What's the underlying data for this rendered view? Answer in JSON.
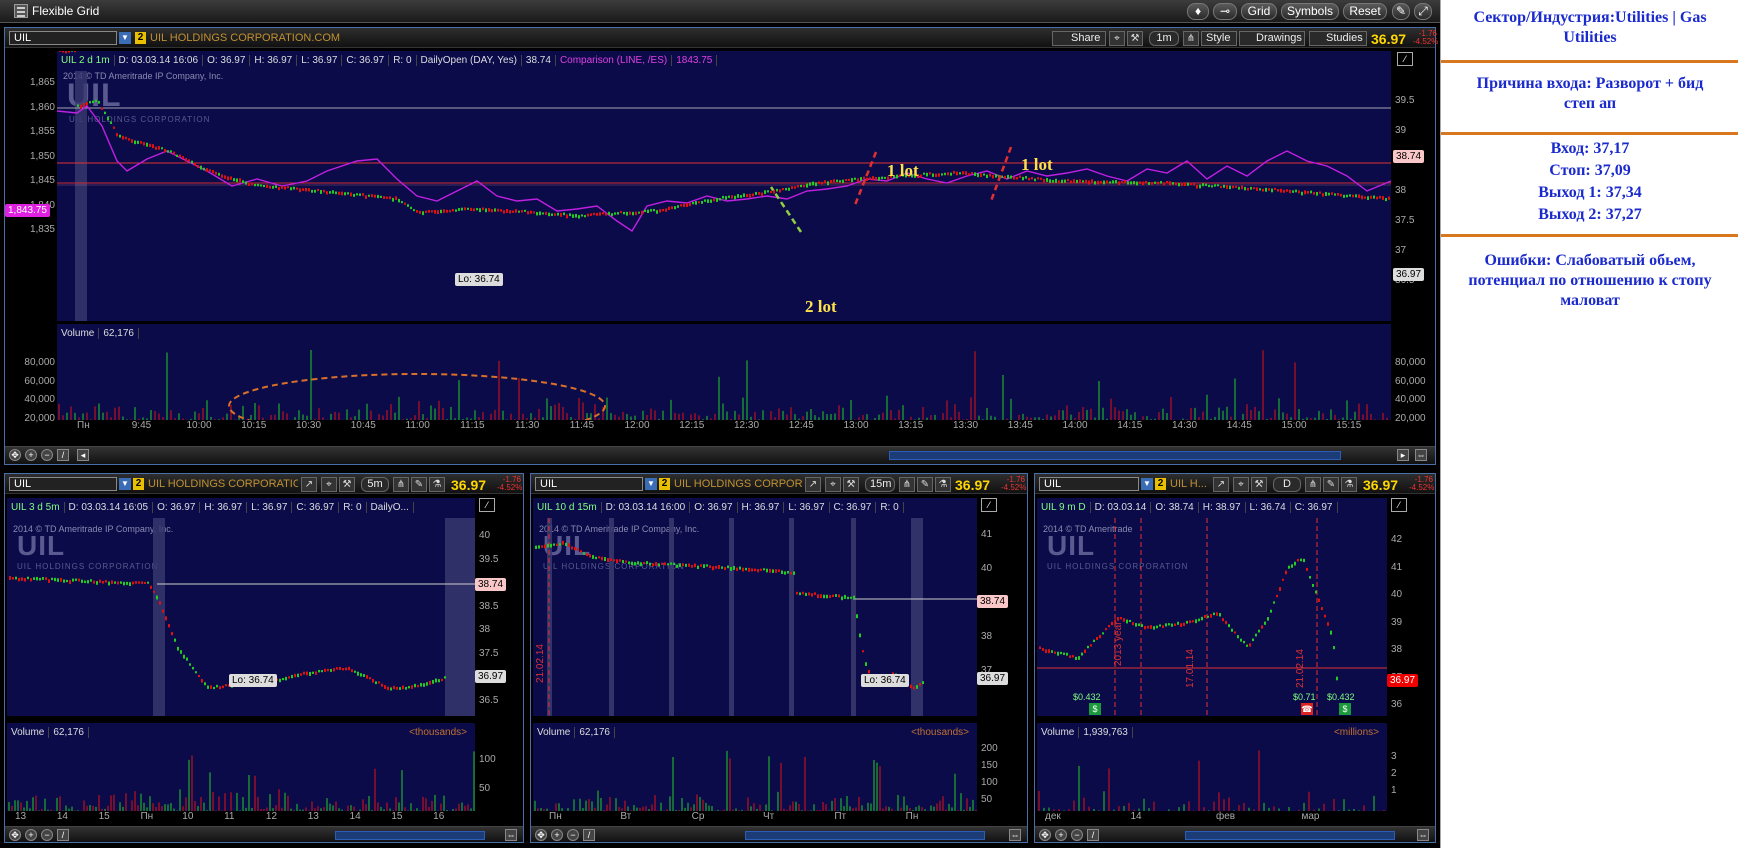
{
  "app": {
    "title": "Flexible Grid",
    "buttons": [
      "Grid",
      "Symbols",
      "Reset"
    ]
  },
  "main_chart": {
    "symbol": "UIL",
    "company": "UIL HOLDINGS CORPORATION.COM",
    "link_badge": "2",
    "price": "36.97",
    "change": "-1.76",
    "change_pct": "-4.52%",
    "toolbar": {
      "share": "Share",
      "interval": "1m",
      "style": "Style",
      "drawings": "Drawings",
      "studies": "Studies"
    },
    "info": {
      "title": "UIL 2 d 1m",
      "d": "D: 03.03.14 16:06",
      "o": "O: 36.97",
      "h": "H: 36.97",
      "l": "L: 36.97",
      "c": "C: 36.97",
      "r": "R: 0",
      "study": "DailyOpen (DAY, Yes)",
      "study_val": "38.74",
      "comparison": "Comparison (LINE, /ES)",
      "comp_val": "1843.75"
    },
    "copyright": "2014 © TD Ameritrade IP Company, Inc.",
    "logo_sub": "UIL HOLDINGS CORPORATION",
    "left_axis": [
      "1,865",
      "1,860",
      "1,855",
      "1,850",
      "1,845",
      "1,840",
      "1,835"
    ],
    "left_tag": "1,843.75",
    "right_axis": [
      "39.5",
      "39",
      "38.5",
      "38",
      "37.5",
      "37",
      "36.5"
    ],
    "open_tag": "38.74",
    "last_tag": "36.97",
    "low_label": "Lo: 36.74",
    "volume_label": "Volume",
    "volume_value": "62,176",
    "volume_axis": [
      "80,000",
      "60,000",
      "40,000",
      "20,000"
    ],
    "x_axis": [
      "Пн",
      "9:45",
      "10:00",
      "10:15",
      "10:30",
      "10:45",
      "11:00",
      "11:15",
      "11:30",
      "11:45",
      "12:00",
      "12:15",
      "12:30",
      "12:45",
      "13:00",
      "13:15",
      "13:30",
      "13:45",
      "14:00",
      "14:15",
      "14:30",
      "14:45",
      "15:00",
      "15:15"
    ],
    "annotations": [
      "1 lot",
      "1 lot",
      "2 lot"
    ]
  },
  "chart_5m": {
    "symbol": "UIL",
    "company": "UIL HOLDINGS CORPORATIO...",
    "interval": "5m",
    "price": "36.97",
    "change": "-1.76",
    "change_pct": "-4.52%",
    "info": {
      "title": "UIL 3 d 5m",
      "d": "D: 03.03.14 16:05",
      "o": "O: 36.97",
      "h": "H: 36.97",
      "l": "L: 36.97",
      "c": "C: 36.97",
      "r": "R: 0",
      "study": "DailyO..."
    },
    "copyright": "2014 © TD Ameritrade IP Company, Inc.",
    "right_axis": [
      "40",
      "39.5",
      "39",
      "38.5",
      "38",
      "37.5",
      "37",
      "36.5"
    ],
    "open_tag": "38.74",
    "last_tag": "36.97",
    "low_label": "Lo: 36.74",
    "volume_label": "Volume",
    "volume_value": "62,176",
    "volume_unit": "<thousands>",
    "volume_axis": [
      "100",
      "50"
    ],
    "x_axis": [
      "13",
      "14",
      "15",
      "Пн",
      "10",
      "11",
      "12",
      "13",
      "14",
      "15",
      "16"
    ]
  },
  "chart_15m": {
    "symbol": "UIL",
    "company": "UIL HOLDINGS CORPOR...",
    "interval": "15m",
    "price": "36.97",
    "change": "-1.76",
    "change_pct": "-4.52%",
    "info": {
      "title": "UIL 10 d 15m",
      "d": "D: 03.03.14 16:00",
      "o": "O: 36.97",
      "h": "H: 36.97",
      "l": "L: 36.97",
      "c": "C: 36.97",
      "r": "R: 0"
    },
    "copyright": "2014 © TD Ameritrade IP Company, Inc.",
    "right_axis": [
      "41",
      "40",
      "39",
      "38",
      "37"
    ],
    "open_tag": "38.74",
    "last_tag": "36.97",
    "low_label": "Lo: 36.74",
    "date_marker": "21.02.14",
    "volume_label": "Volume",
    "volume_value": "62,176",
    "volume_unit": "<thousands>",
    "volume_axis": [
      "200",
      "150",
      "100",
      "50"
    ],
    "x_axis": [
      "Пн",
      "Вт",
      "Ср",
      "Чт",
      "Пт",
      "Пн"
    ]
  },
  "chart_d": {
    "symbol": "UIL",
    "company": "UIL H...",
    "interval": "D",
    "price": "36.97",
    "change": "-1.76",
    "change_pct": "-4.52%",
    "info": {
      "title": "UIL 9 m D",
      "d": "D: 03.03.14",
      "o": "O: 38.74",
      "h": "H: 38.97",
      "l": "L: 36.74",
      "c": "C: 36.97"
    },
    "copyright": "2014 © TD Ameritrade",
    "right_axis": [
      "42",
      "41",
      "40",
      "39",
      "38",
      "37",
      "36"
    ],
    "last_tag": "36.97",
    "markers": [
      "$0.432",
      "$0.71",
      "$0.432"
    ],
    "date_markers": [
      "2013 year",
      "17.01.14",
      "21.02.14"
    ],
    "volume_label": "Volume",
    "volume_value": "1,939,763",
    "volume_unit": "<millions>",
    "volume_axis": [
      "3",
      "2",
      "1"
    ],
    "x_axis": [
      "дек",
      "14",
      "фев",
      "мар"
    ]
  },
  "sidebar": {
    "sector": "Сектор/Индустрия:Utilities | Gas Utilities",
    "reason": "Причина входа: Разворот +  бид степ ап",
    "entry": "Вход: 37,17",
    "stop": "Стоп: 37,09",
    "exit1": "Выход 1: 37,34",
    "exit2": "Выход 2: 37,27",
    "errors": "Ошибки: Слабоватый обьем, потенциал по отношению к стопу маловат"
  },
  "colors": {
    "accent": "#ffd700",
    "plot_bg": "#0b0b4a",
    "comparison": "#c020e0",
    "up": "#22cc22",
    "down": "#e01010",
    "sidebar_text": "#1a2acd",
    "separator": "#d8781e"
  }
}
